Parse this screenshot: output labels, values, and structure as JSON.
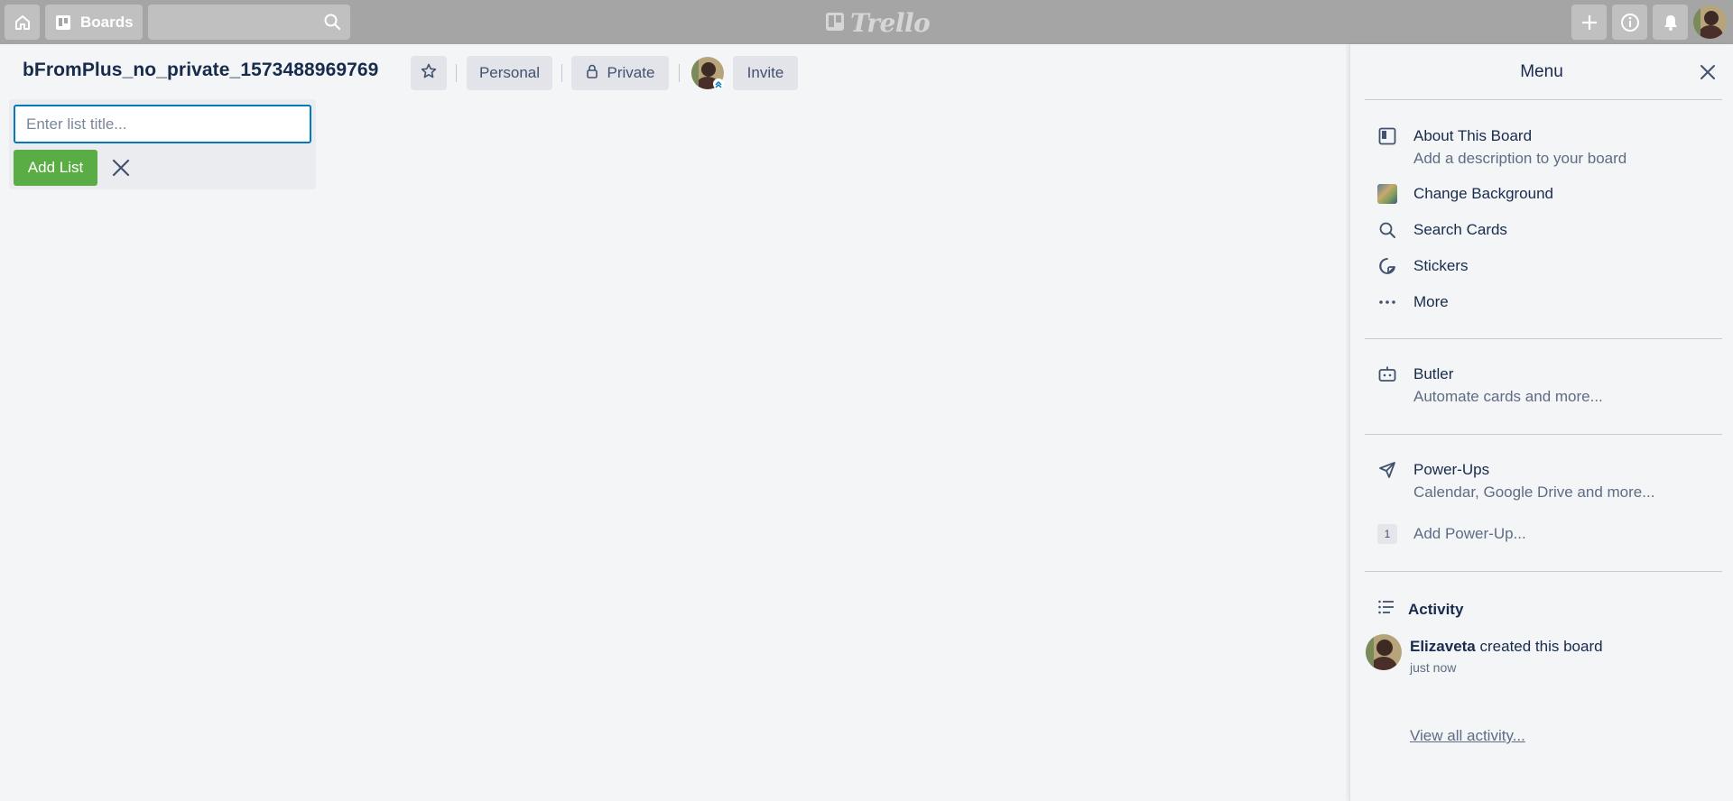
{
  "header": {
    "boards_label": "Boards",
    "search_placeholder": "",
    "logo_text": "Trello",
    "icons": [
      "home-icon",
      "boards-icon",
      "search-icon",
      "plus-icon",
      "info-icon",
      "bell-icon",
      "avatar"
    ]
  },
  "board": {
    "title": "bFromPlus_no_private_1573488969769",
    "team_label": "Personal",
    "visibility_label": "Private",
    "invite_label": "Invite"
  },
  "add_list": {
    "placeholder": "Enter list title...",
    "value": "",
    "button_label": "Add List"
  },
  "menu": {
    "title": "Menu",
    "items": [
      {
        "icon": "board-icon",
        "label": "About This Board",
        "sub": "Add a description to your board"
      },
      {
        "icon": "background-thumbnail",
        "label": "Change Background"
      },
      {
        "icon": "search-icon",
        "label": "Search Cards"
      },
      {
        "icon": "sticker-icon",
        "label": "Stickers"
      },
      {
        "icon": "more-icon",
        "label": "More"
      },
      {
        "icon": "butler-icon",
        "label": "Butler",
        "sub": "Automate cards and more..."
      },
      {
        "icon": "rocket-icon",
        "label": "Power-Ups",
        "sub": "Calendar, Google Drive and more..."
      },
      {
        "icon": "count-badge",
        "badge": "1",
        "label": "Add Power-Up..."
      }
    ],
    "activity": {
      "title": "Activity",
      "entries": [
        {
          "user": "Elizaveta",
          "action": "created this board",
          "time": "just now"
        }
      ],
      "view_all_label": "View all activity..."
    }
  },
  "colors": {
    "header_bg": "#a5a5a5",
    "board_bg": "#f4f5f7",
    "add_button": "#5aac44",
    "input_focus": "#0079bf",
    "text_primary": "#172b4d",
    "text_secondary": "#5e6c84"
  }
}
